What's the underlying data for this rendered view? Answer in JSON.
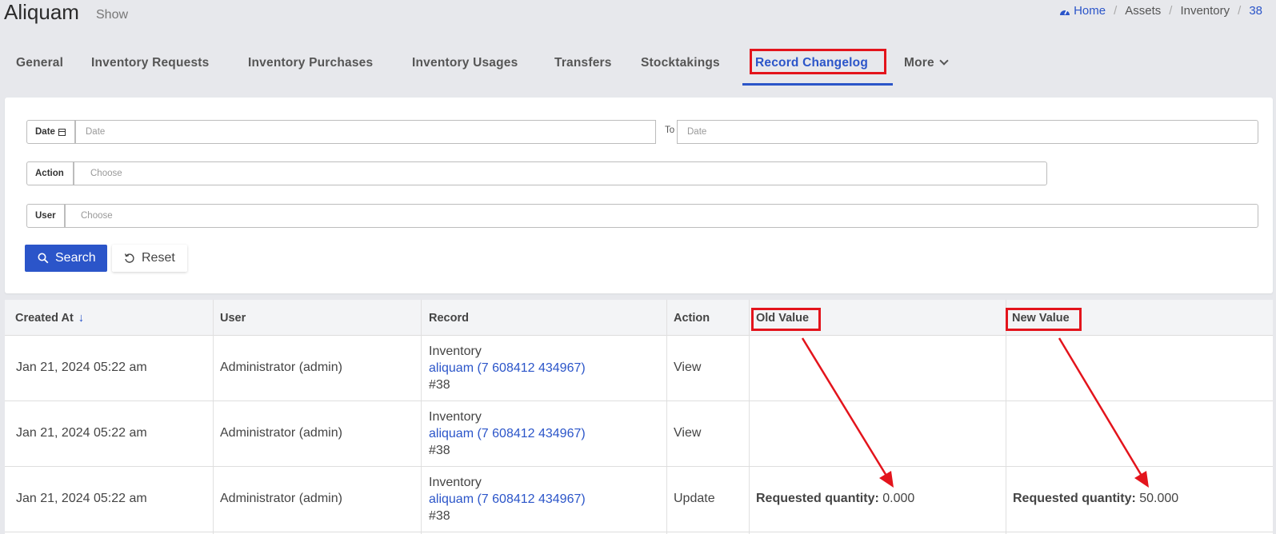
{
  "header": {
    "title": "Aliquam",
    "subtitle": "Show",
    "breadcrumb": [
      "Home",
      "Assets",
      "Inventory",
      "38"
    ]
  },
  "tabs": [
    {
      "label": "General"
    },
    {
      "label": "Inventory Requests"
    },
    {
      "label": "Inventory Purchases"
    },
    {
      "label": "Inventory Usages"
    },
    {
      "label": "Transfers"
    },
    {
      "label": "Stocktakings"
    },
    {
      "label": "Record Changelog",
      "active": true
    },
    {
      "label": "More"
    }
  ],
  "filters": {
    "date_label": "Date",
    "date_from_placeholder": "Date",
    "to_label": "To",
    "date_to_placeholder": "Date",
    "action_label": "Action",
    "action_placeholder": "Choose",
    "user_label": "User",
    "user_placeholder": "Choose",
    "search_label": "Search",
    "reset_label": "Reset"
  },
  "table": {
    "columns": [
      "Created At",
      "User",
      "Record",
      "Action",
      "Old Value",
      "New Value"
    ],
    "rows": [
      {
        "created_at": "Jan 21, 2024 05:22 am",
        "user": "Administrator (admin)",
        "record_type": "Inventory",
        "record_link": "aliquam (7 608412 434967)",
        "record_id": "#38",
        "action": "View",
        "old_key": "",
        "old_val": "",
        "new_key": "",
        "new_val": ""
      },
      {
        "created_at": "Jan 21, 2024 05:22 am",
        "user": "Administrator (admin)",
        "record_type": "Inventory",
        "record_link": "aliquam (7 608412 434967)",
        "record_id": "#38",
        "action": "View",
        "old_key": "",
        "old_val": "",
        "new_key": "",
        "new_val": ""
      },
      {
        "created_at": "Jan 21, 2024 05:22 am",
        "user": "Administrator (admin)",
        "record_type": "Inventory",
        "record_link": "aliquam (7 608412 434967)",
        "record_id": "#38",
        "action": "Update",
        "old_key": "Requested quantity:",
        "old_val": "0.000",
        "new_key": "Requested quantity:",
        "new_val": "50.000"
      }
    ]
  },
  "colors": {
    "accent": "#2b55c9",
    "highlight": "#e3141c"
  }
}
